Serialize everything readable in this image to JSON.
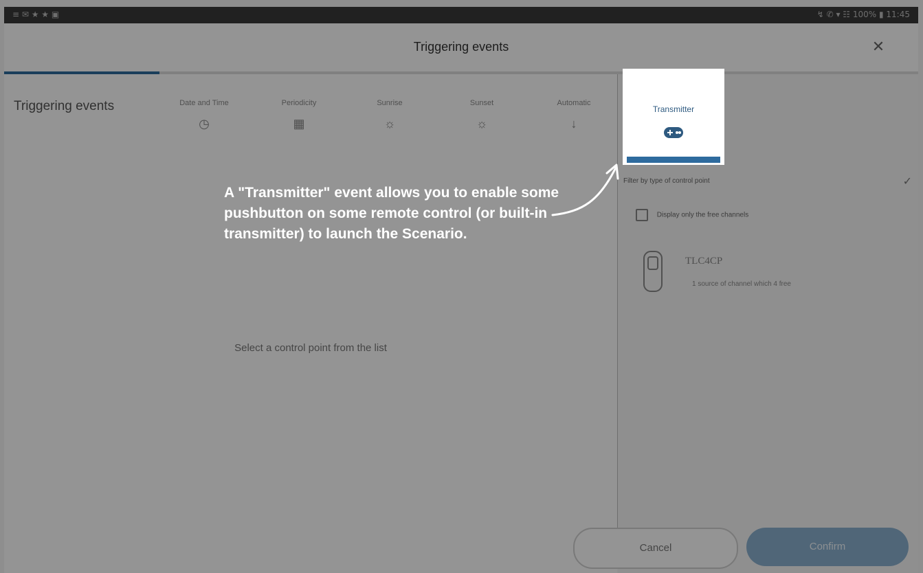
{
  "status_bar": {
    "left": "≡ ✉ ★ ★ ▣",
    "right": "↯ ✆ ▾ ☷ 100% ▮ 11:45"
  },
  "header": {
    "title": "Triggering events",
    "close_glyph": "✕"
  },
  "progress": {
    "fraction": 0.17
  },
  "steps": {
    "title": "Triggering events",
    "tabs": [
      {
        "label": "Date and Time",
        "icon": "◷",
        "icon_name": "clock-icon"
      },
      {
        "label": "Periodicity",
        "icon": "▦",
        "icon_name": "calendar-icon"
      },
      {
        "label": "Sunrise",
        "icon": "☼",
        "icon_name": "sunrise-icon"
      },
      {
        "label": "Sunset",
        "icon": "☼",
        "icon_name": "sunset-icon"
      },
      {
        "label": "Automatic",
        "icon": "↓",
        "icon_name": "automatic-icon"
      }
    ]
  },
  "main": {
    "empty_message": "Select a control point from the list"
  },
  "highlight_card": {
    "label": "Transmitter",
    "icon_name": "transmitter-icon"
  },
  "callout": {
    "text": "A \"Transmitter\" event allows you to enable some pushbutton on some remote control (or built-in transmitter) to launch the Scenario."
  },
  "side_panel": {
    "filter_label": "Filter by type of control point",
    "checkbox_label": "Display only the free channels",
    "device": {
      "name": "TLC4CP",
      "subtitle": "1 source of channel which 4 free"
    }
  },
  "footer": {
    "cancel_label": "Cancel",
    "confirm_label": "Confirm"
  },
  "colors": {
    "accent": "#2e6b9e",
    "confirm_bg": "#8ab0cf",
    "overlay": "rgba(0,0,0,0.42)"
  }
}
